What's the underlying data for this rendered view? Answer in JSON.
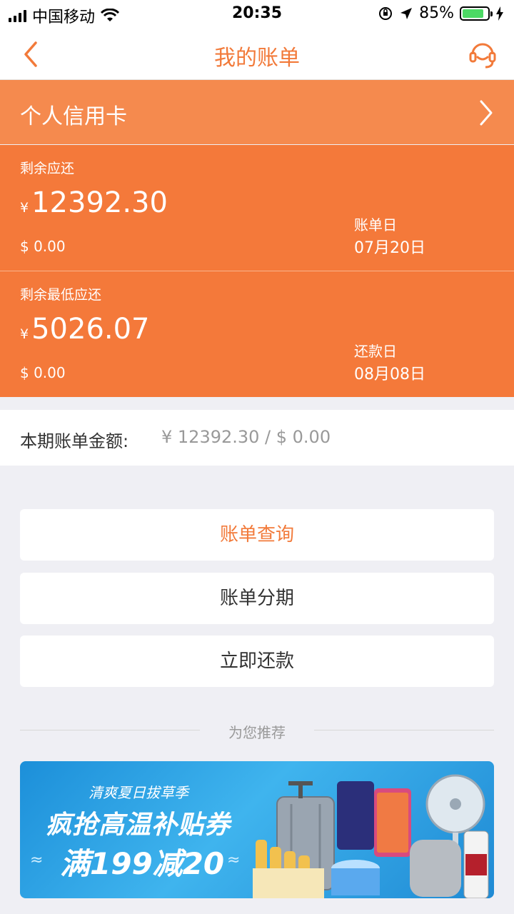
{
  "status_bar": {
    "carrier": "中国移动",
    "time": "20:35",
    "battery_percent": "85%",
    "battery_level": 0.85
  },
  "nav": {
    "title": "我的账单"
  },
  "card": {
    "name": "个人信用卡"
  },
  "remaining": {
    "label": "剩余应还",
    "currency_symbol": "¥",
    "amount": "12392.30",
    "usd": "$ 0.00",
    "date_label": "账单日",
    "date_value": "07月20日"
  },
  "min_remaining": {
    "label": "剩余最低应还",
    "currency_symbol": "¥",
    "amount": "5026.07",
    "usd": "$ 0.00",
    "date_label": "还款日",
    "date_value": "08月08日"
  },
  "summary": {
    "label": "本期账单金额:",
    "value": "¥ 12392.30 / $ 0.00"
  },
  "buttons": {
    "query": "账单查询",
    "installment": "账单分期",
    "repay": "立即还款"
  },
  "recommend": {
    "title": "为您推荐"
  },
  "banner": {
    "subtitle": "清爽夏日拔草季",
    "title": "疯抢高温补贴券",
    "promo": "满199减20"
  },
  "colors": {
    "accent": "#f27a3a",
    "orange_block": "#f4793a",
    "card_header": "#f58a4e",
    "background": "#efeff4"
  }
}
